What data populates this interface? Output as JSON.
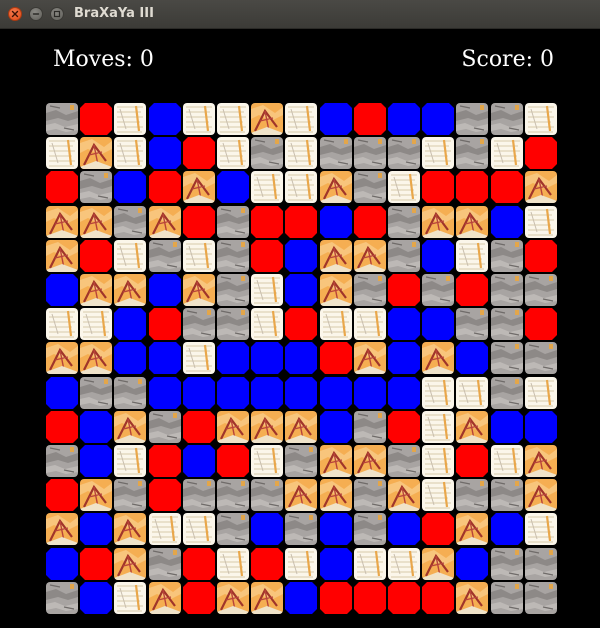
{
  "window": {
    "title": "BraXaYa III"
  },
  "hud": {
    "moves_text": "Moves: 0",
    "score_text": "Score: 0"
  },
  "tile_types": {
    "r": {
      "name": "red",
      "color": "#ff0000"
    },
    "b": {
      "name": "blue",
      "color": "#0000ff"
    },
    "g": {
      "name": "gray-stone",
      "color": "#a8a4a2"
    },
    "w": {
      "name": "white-paper",
      "color": "#fbf6ea"
    },
    "o": {
      "name": "orange-feather",
      "color": "#f5ae52"
    }
  },
  "board": {
    "cols": 15,
    "rows": 15,
    "grid": [
      [
        "g",
        "r",
        "w",
        "b",
        "w",
        "w",
        "o",
        "w",
        "b",
        "r",
        "b",
        "b",
        "g",
        "g",
        "w"
      ],
      [
        "w",
        "o",
        "w",
        "b",
        "r",
        "w",
        "g",
        "w",
        "g",
        "g",
        "g",
        "w",
        "g",
        "w",
        "r"
      ],
      [
        "r",
        "g",
        "b",
        "r",
        "o",
        "b",
        "w",
        "w",
        "o",
        "g",
        "w",
        "r",
        "r",
        "r",
        "o"
      ],
      [
        "o",
        "o",
        "g",
        "o",
        "r",
        "g",
        "r",
        "r",
        "b",
        "r",
        "g",
        "o",
        "o",
        "b",
        "w"
      ],
      [
        "o",
        "r",
        "w",
        "g",
        "w",
        "g",
        "r",
        "b",
        "o",
        "o",
        "g",
        "b",
        "w",
        "g",
        "r"
      ],
      [
        "b",
        "o",
        "o",
        "b",
        "o",
        "g",
        "w",
        "b",
        "o",
        "g",
        "r",
        "g",
        "r",
        "g",
        "g"
      ],
      [
        "w",
        "w",
        "b",
        "r",
        "g",
        "g",
        "w",
        "r",
        "w",
        "w",
        "b",
        "b",
        "g",
        "g",
        "r"
      ],
      [
        "o",
        "o",
        "b",
        "b",
        "w",
        "b",
        "b",
        "b",
        "r",
        "o",
        "b",
        "o",
        "b",
        "g",
        "g"
      ],
      [
        "b",
        "g",
        "g",
        "b",
        "b",
        "b",
        "b",
        "b",
        "b",
        "b",
        "b",
        "w",
        "w",
        "g",
        "w"
      ],
      [
        "r",
        "b",
        "o",
        "g",
        "r",
        "o",
        "o",
        "o",
        "b",
        "g",
        "r",
        "w",
        "o",
        "b",
        "b"
      ],
      [
        "g",
        "b",
        "w",
        "r",
        "b",
        "r",
        "w",
        "g",
        "o",
        "o",
        "g",
        "w",
        "r",
        "w",
        "o"
      ],
      [
        "r",
        "o",
        "g",
        "r",
        "g",
        "g",
        "g",
        "o",
        "o",
        "g",
        "o",
        "w",
        "g",
        "g",
        "o"
      ],
      [
        "o",
        "b",
        "o",
        "w",
        "w",
        "g",
        "b",
        "g",
        "b",
        "g",
        "b",
        "r",
        "o",
        "b",
        "w"
      ],
      [
        "b",
        "r",
        "o",
        "g",
        "r",
        "w",
        "r",
        "w",
        "b",
        "w",
        "w",
        "o",
        "b",
        "g",
        "g"
      ],
      [
        "g",
        "b",
        "w",
        "o",
        "r",
        "o",
        "o",
        "b",
        "r",
        "r",
        "r",
        "r",
        "o",
        "g",
        "g"
      ]
    ]
  }
}
